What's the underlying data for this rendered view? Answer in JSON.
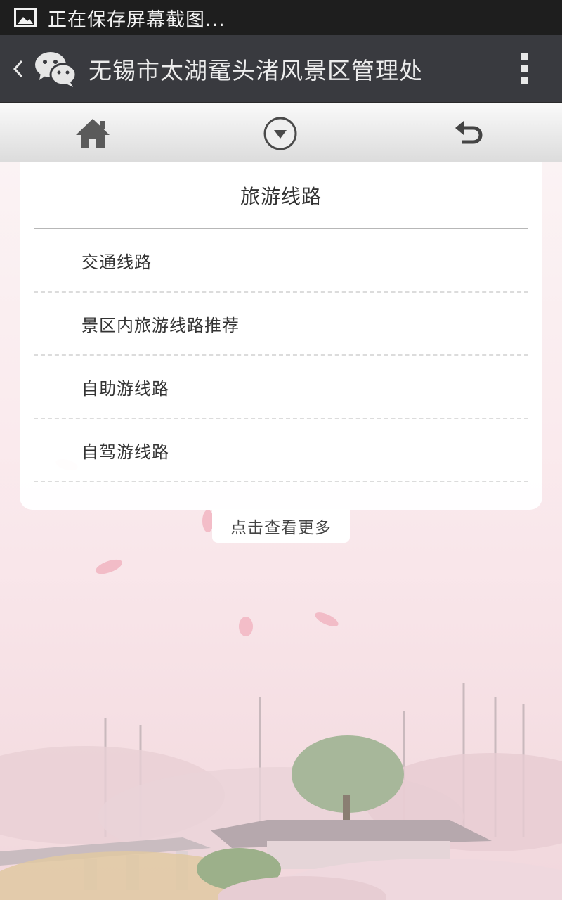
{
  "status_bar": {
    "icon": "image-icon",
    "text": "正在保存屏幕截图..."
  },
  "header": {
    "back_icon": "chevron-left-icon",
    "app_icon": "wechat-icon",
    "title": "无锡市太湖鼋头渚风景区管理处",
    "menu_icon": "more-vertical-icon"
  },
  "toolbar": {
    "home_icon": "home-icon",
    "menu_icon": "dropdown-circle-icon",
    "back_icon": "undo-arrow-icon"
  },
  "content": {
    "section_title": "旅游线路",
    "routes": [
      {
        "label": "交通线路"
      },
      {
        "label": "景区内旅游线路推荐"
      },
      {
        "label": "自助游线路"
      },
      {
        "label": "自驾游线路"
      }
    ],
    "more_label": "点击查看更多"
  },
  "colors": {
    "status_bar_bg": "#1e1e1e",
    "title_bar_bg": "#393a3f",
    "background_tint": "#f7e3e7"
  }
}
